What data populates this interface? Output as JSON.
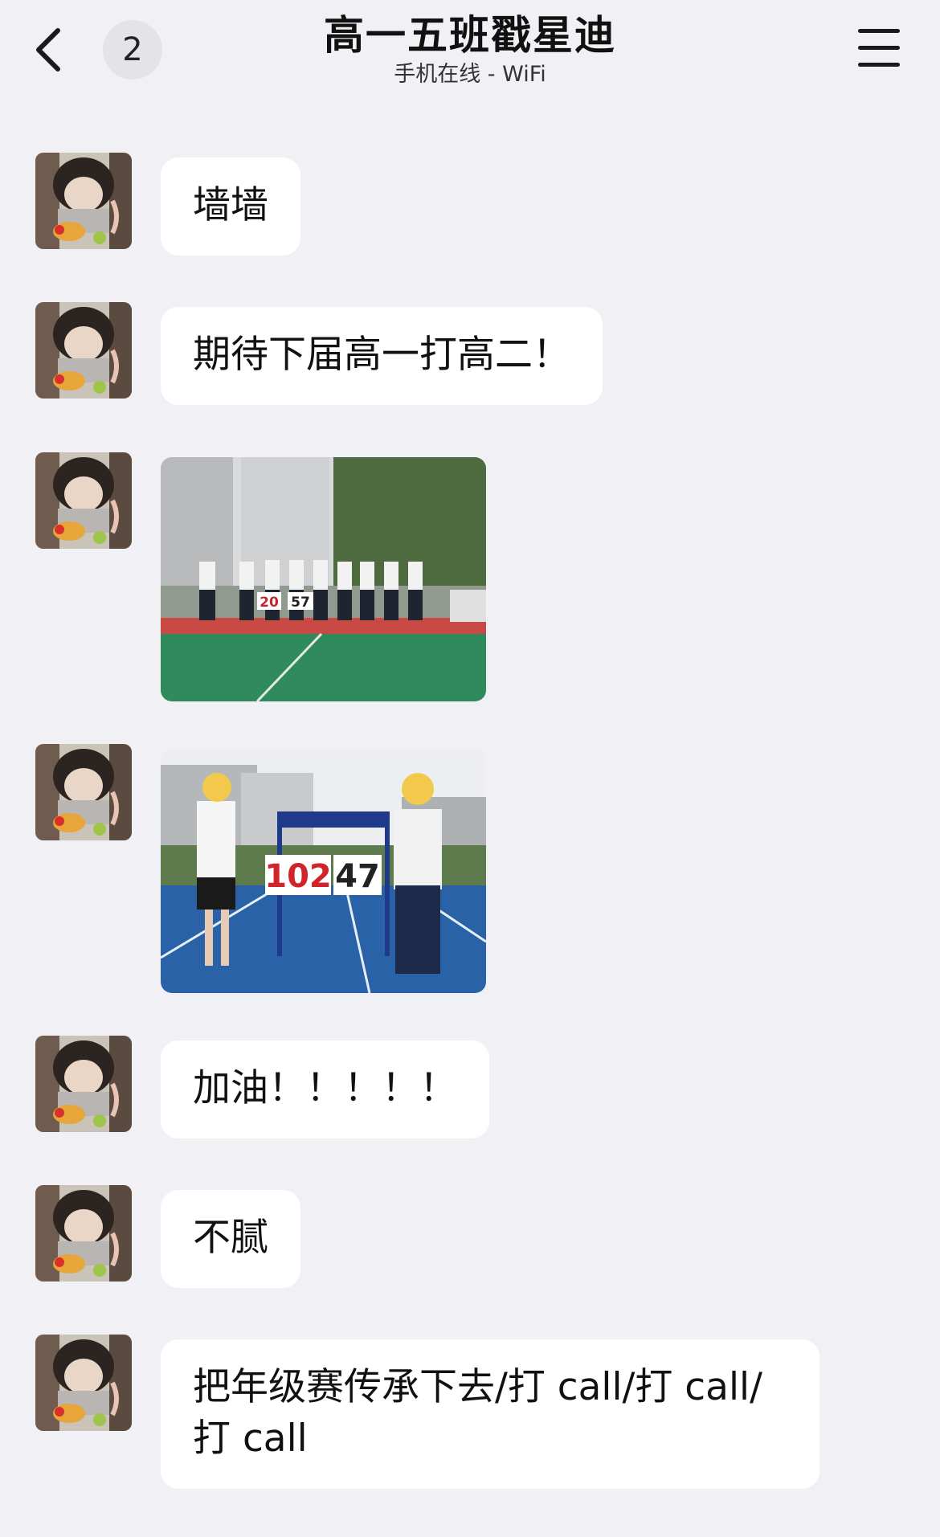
{
  "header": {
    "back_label": "<",
    "unread_count": "2",
    "title": "高一五班戳星迪",
    "status": "手机在线 - WiFi",
    "menu_icon": "hamburger-menu-icon"
  },
  "messages": [
    {
      "type": "text",
      "text": "墙墙"
    },
    {
      "type": "text",
      "text": "期待下届高一打高二！"
    },
    {
      "type": "image",
      "scoreboard": [
        "20",
        "57"
      ]
    },
    {
      "type": "image",
      "scoreboard": [
        "102",
        "47"
      ]
    },
    {
      "type": "text",
      "text": "加油！！！！！"
    },
    {
      "type": "text",
      "text": "不腻"
    },
    {
      "type": "text",
      "text": "把年级赛传承下去/打 call/打 call/\n打 call"
    }
  ],
  "colors": {
    "background": "#f1f1f5",
    "bubble": "#ffffff",
    "badge": "#e3e3e8"
  }
}
